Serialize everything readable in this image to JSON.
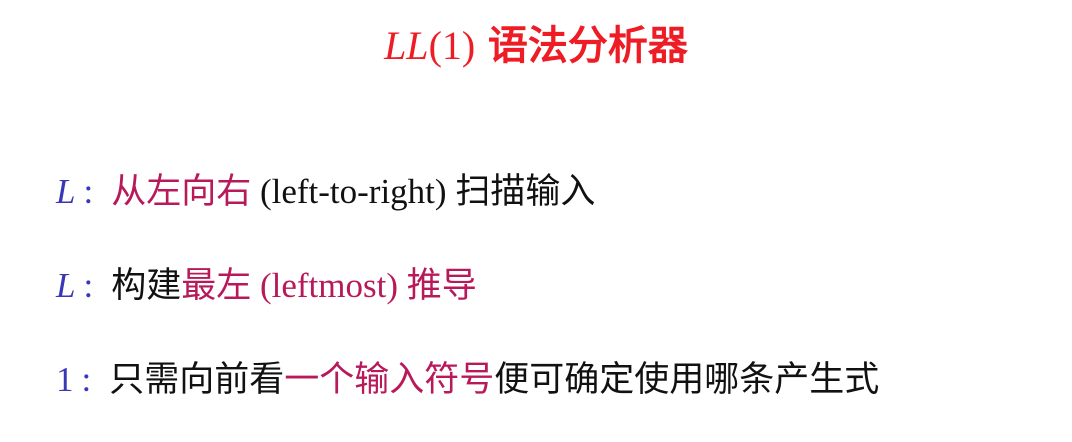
{
  "colors": {
    "title": "#ee1c25",
    "key": "#3a36b8",
    "highlight": "#b8195a",
    "text": "#111111"
  },
  "title": {
    "math": "LL",
    "paren": "(1)",
    "cjk": "语法分析器"
  },
  "lines": [
    {
      "key": "L",
      "sep": ":",
      "highlight": "从左向右",
      "plain_paren": "(left-to-right)",
      "rest": "扫描输入"
    },
    {
      "key": "L",
      "sep": ":",
      "pre": "构建",
      "highlight": "最左",
      "highlight_paren": "(leftmost)",
      "highlight_tail": "推导"
    },
    {
      "key": "1",
      "sep": ":",
      "pre": "只需向前看",
      "highlight": "一个输入符号",
      "rest": "便可确定使用哪条产生式"
    }
  ]
}
